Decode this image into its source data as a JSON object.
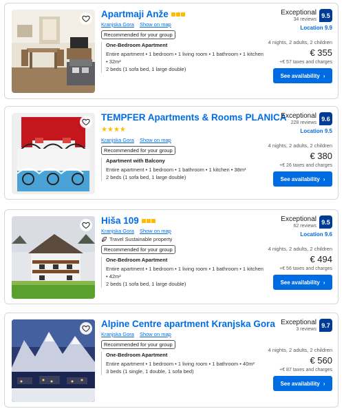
{
  "results": [
    {
      "name": "Apartmaji Anže",
      "stars": 3,
      "star_style": "squares",
      "location": "Kranjska Gora",
      "show_on_map": "Show on map",
      "sustainable": "",
      "recommended": "Recommended for your group",
      "unit_name": "One-Bedroom Apartment",
      "unit_desc": "Entire apartment • 1 bedroom • 1 living room • 1 bathroom • 1 kitchen • 32m²",
      "unit_beds": "2 beds (1 sofa bed, 1 large double)",
      "rating_word": "Exceptional",
      "reviews": "34 reviews",
      "score": "9.5",
      "location_score": "Location 9.9",
      "stay": "4 nights, 2 adults, 2 children",
      "price": "€ 355",
      "taxes": "+€ 57 taxes and charges",
      "cta": "See availability",
      "photo": "interior"
    },
    {
      "name": "TEMPFER Apartments & Rooms PLANICA",
      "stars": 4,
      "star_style": "stars",
      "location": "Kranjska Gora",
      "show_on_map": "Show on map",
      "sustainable": "",
      "recommended": "Recommended for your group",
      "unit_name": "Apartment with Balcony",
      "unit_desc": "Entire apartment • 1 bedroom • 1 bathroom • 1 kitchen • 38m²",
      "unit_beds": "2 beds (1 sofa bed, 1 large double)",
      "rating_word": "Exceptional",
      "reviews": "228 reviews",
      "score": "9.6",
      "location_score": "Location 9.5",
      "stay": "4 nights, 2 adults, 2 children",
      "price": "€ 380",
      "taxes": "+€ 26 taxes and charges",
      "cta": "See availability",
      "photo": "bedroom"
    },
    {
      "name": "Hiša 109",
      "stars": 3,
      "star_style": "squares",
      "location": "Kranjska Gora",
      "show_on_map": "Show on map",
      "sustainable": "Travel Sustainable property",
      "recommended": "Recommended for your group",
      "unit_name": "One-Bedroom Apartment",
      "unit_desc": "Entire apartment • 1 bedroom • 1 living room • 1 bathroom • 1 kitchen • 42m²",
      "unit_beds": "2 beds (1 sofa bed, 1 large double)",
      "rating_word": "Exceptional",
      "reviews": "62 reviews",
      "score": "9.5",
      "location_score": "Location 9.6",
      "stay": "4 nights, 2 adults, 2 children",
      "price": "€ 494",
      "taxes": "+€ 56 taxes and charges",
      "cta": "See availability",
      "photo": "house"
    },
    {
      "name": "Alpine Centre apartment Kranjska Gora",
      "stars": 0,
      "star_style": "none",
      "location": "Kranjska Gora",
      "show_on_map": "Show on map",
      "sustainable": "",
      "recommended": "Recommended for your group",
      "unit_name": "One-Bedroom Apartment",
      "unit_desc": "Entire apartment • 1 bedroom • 1 living room • 1 bathroom • 40m²",
      "unit_beds": "3 beds (1 single, 1 double, 1 sofa bed)",
      "rating_word": "Exceptional",
      "reviews": "3 reviews",
      "score": "9.7",
      "location_score": "",
      "stay": "4 nights, 2 adults, 2 children",
      "price": "€ 560",
      "taxes": "+€ 87 taxes and charges",
      "cta": "See availability",
      "photo": "mountain"
    }
  ]
}
